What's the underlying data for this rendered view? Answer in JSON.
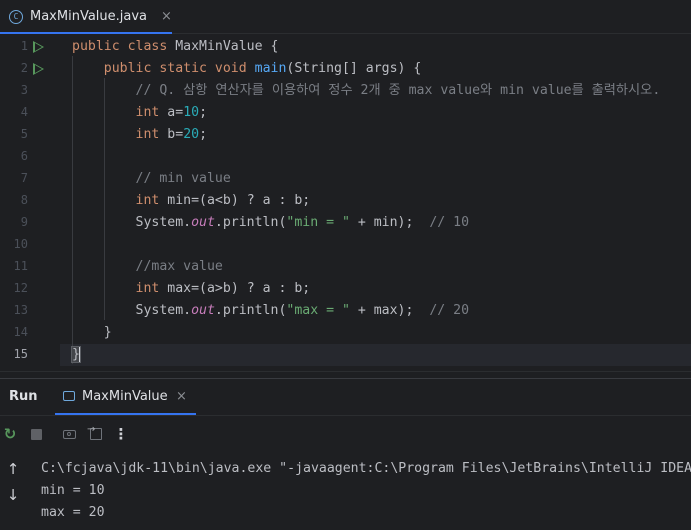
{
  "editor_tab": {
    "file_icon": "C",
    "file_name": "MaxMinValue.java",
    "close_glyph": "×"
  },
  "editor": {
    "current_line": 15,
    "lines": [
      {
        "n": "1",
        "run": true,
        "tokens": [
          [
            "kw",
            "public "
          ],
          [
            "kw",
            "class "
          ],
          [
            "p",
            "MaxMinValue {"
          ]
        ]
      },
      {
        "n": "2",
        "run": true,
        "tokens": [
          [
            "p",
            "    "
          ],
          [
            "kw",
            "public "
          ],
          [
            "kw",
            "static "
          ],
          [
            "kw",
            "void "
          ],
          [
            "fn",
            "main"
          ],
          [
            "p",
            "(String[] args) {"
          ]
        ]
      },
      {
        "n": "3",
        "run": false,
        "tokens": [
          [
            "p",
            "        "
          ],
          [
            "cmt",
            "// Q. 삼항 연산자를 이용하여 정수 2개 중 max value와 min value를 출력하시오."
          ]
        ]
      },
      {
        "n": "4",
        "run": false,
        "tokens": [
          [
            "p",
            "        "
          ],
          [
            "kw",
            "int "
          ],
          [
            "p",
            "a="
          ],
          [
            "num",
            "10"
          ],
          [
            "p",
            ";"
          ]
        ]
      },
      {
        "n": "5",
        "run": false,
        "tokens": [
          [
            "p",
            "        "
          ],
          [
            "kw",
            "int "
          ],
          [
            "p",
            "b="
          ],
          [
            "num",
            "20"
          ],
          [
            "p",
            ";"
          ]
        ]
      },
      {
        "n": "6",
        "run": false,
        "tokens": []
      },
      {
        "n": "7",
        "run": false,
        "tokens": [
          [
            "p",
            "        "
          ],
          [
            "cmt",
            "// min value"
          ]
        ]
      },
      {
        "n": "8",
        "run": false,
        "tokens": [
          [
            "p",
            "        "
          ],
          [
            "kw",
            "int "
          ],
          [
            "p",
            "min=(a<b) ? a : b;"
          ]
        ]
      },
      {
        "n": "9",
        "run": false,
        "tokens": [
          [
            "p",
            "        System."
          ],
          [
            "fld",
            "out"
          ],
          [
            "p",
            ".println("
          ],
          [
            "str",
            "\"min = \""
          ],
          [
            "p",
            " + min);  "
          ],
          [
            "cmt",
            "// 10"
          ]
        ]
      },
      {
        "n": "10",
        "run": false,
        "tokens": []
      },
      {
        "n": "11",
        "run": false,
        "tokens": [
          [
            "p",
            "        "
          ],
          [
            "cmt",
            "//max value"
          ]
        ]
      },
      {
        "n": "12",
        "run": false,
        "tokens": [
          [
            "p",
            "        "
          ],
          [
            "kw",
            "int "
          ],
          [
            "p",
            "max=(a>b) ? a : b;"
          ]
        ]
      },
      {
        "n": "13",
        "run": false,
        "tokens": [
          [
            "p",
            "        System."
          ],
          [
            "fld",
            "out"
          ],
          [
            "p",
            ".println("
          ],
          [
            "str",
            "\"max = \""
          ],
          [
            "p",
            " + max);  "
          ],
          [
            "cmt",
            "// 20"
          ]
        ]
      },
      {
        "n": "14",
        "run": false,
        "tokens": [
          [
            "p",
            "    }"
          ]
        ]
      },
      {
        "n": "15",
        "run": false,
        "tokens": [
          [
            "brace",
            "}"
          ]
        ]
      }
    ]
  },
  "run_panel": {
    "title": "Run",
    "tab_label": "MaxMinValue",
    "close_glyph": "×",
    "toolbar": {
      "rerun": "↻",
      "more": "⋮"
    },
    "scroll": {
      "up": "↑",
      "down": "↓"
    },
    "output": [
      "C:\\fcjava\\jdk-11\\bin\\java.exe \"-javaagent:C:\\Program Files\\JetBrains\\IntelliJ IDEA",
      "min = 10",
      "max = 20"
    ]
  },
  "colors": {
    "background": "#1e1f22",
    "keyword": "#cf8e6d",
    "method": "#56a8f5",
    "number": "#2aacb8",
    "string": "#6aab73",
    "comment": "#7a7e85",
    "field": "#c77dbb",
    "accent": "#3574f0"
  }
}
